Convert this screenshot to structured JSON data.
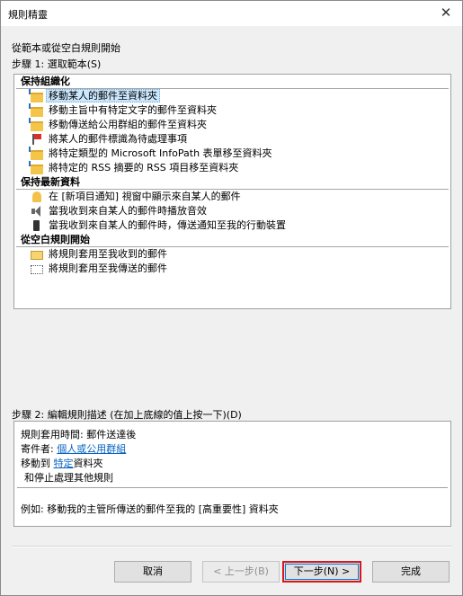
{
  "window": {
    "title": "規則精靈",
    "close_glyph": "✕"
  },
  "instruction": "從範本或從空白規則開始",
  "step1_label": "步驟 1: 選取範本(S)",
  "groups": [
    {
      "label": "保持組織化",
      "items": [
        {
          "label": "移動某人的郵件至資料夾",
          "icon": "folder-arrow-icon",
          "selected": true
        },
        {
          "label": "移動主旨中有特定文字的郵件至資料夾",
          "icon": "folder-arrow-icon"
        },
        {
          "label": "移動傳送給公用群組的郵件至資料夾",
          "icon": "folder-arrow-icon"
        },
        {
          "label": "將某人的郵件標識為待處理事項",
          "icon": "flag-icon"
        },
        {
          "label": "將特定類型的 Microsoft InfoPath 表單移至資料夾",
          "icon": "folder-arrow-icon"
        },
        {
          "label": "將特定的 RSS 摘要的 RSS 項目移至資料夾",
          "icon": "folder-arrow-icon"
        }
      ]
    },
    {
      "label": "保持最新資料",
      "items": [
        {
          "label": "在 [新項目通知] 視窗中顯示來自某人的郵件",
          "icon": "bell-icon"
        },
        {
          "label": "當我收到來自某人的郵件時播放音效",
          "icon": "speaker-icon"
        },
        {
          "label": "當我收到來自某人的郵件時，傳送通知至我的行動裝置",
          "icon": "phone-icon"
        }
      ]
    },
    {
      "label": "從空白規則開始",
      "items": [
        {
          "label": "將規則套用至我收到的郵件",
          "icon": "envelope-icon"
        },
        {
          "label": "將規則套用至我傳送的郵件",
          "icon": "send-mail-icon"
        }
      ]
    }
  ],
  "step2_label": "步驟 2: 編輯規則描述 (在加上底線的值上按一下)(D)",
  "description": {
    "line1": "規則套用時間: 郵件送達後",
    "line2_prefix": "寄件者: ",
    "line2_link": "個人或公用群組",
    "line3_prefix": "移動到 ",
    "line3_link": "特定",
    "line3_suffix": "資料夾",
    "line4": "和停止處理其他規則",
    "example": "例如: 移動我的主管所傳送的郵件至我的 [高重要性] 資料夾"
  },
  "buttons": {
    "cancel": "取消",
    "back": "< 上一步(B)",
    "next": "下一步(N) >",
    "finish": "完成"
  }
}
